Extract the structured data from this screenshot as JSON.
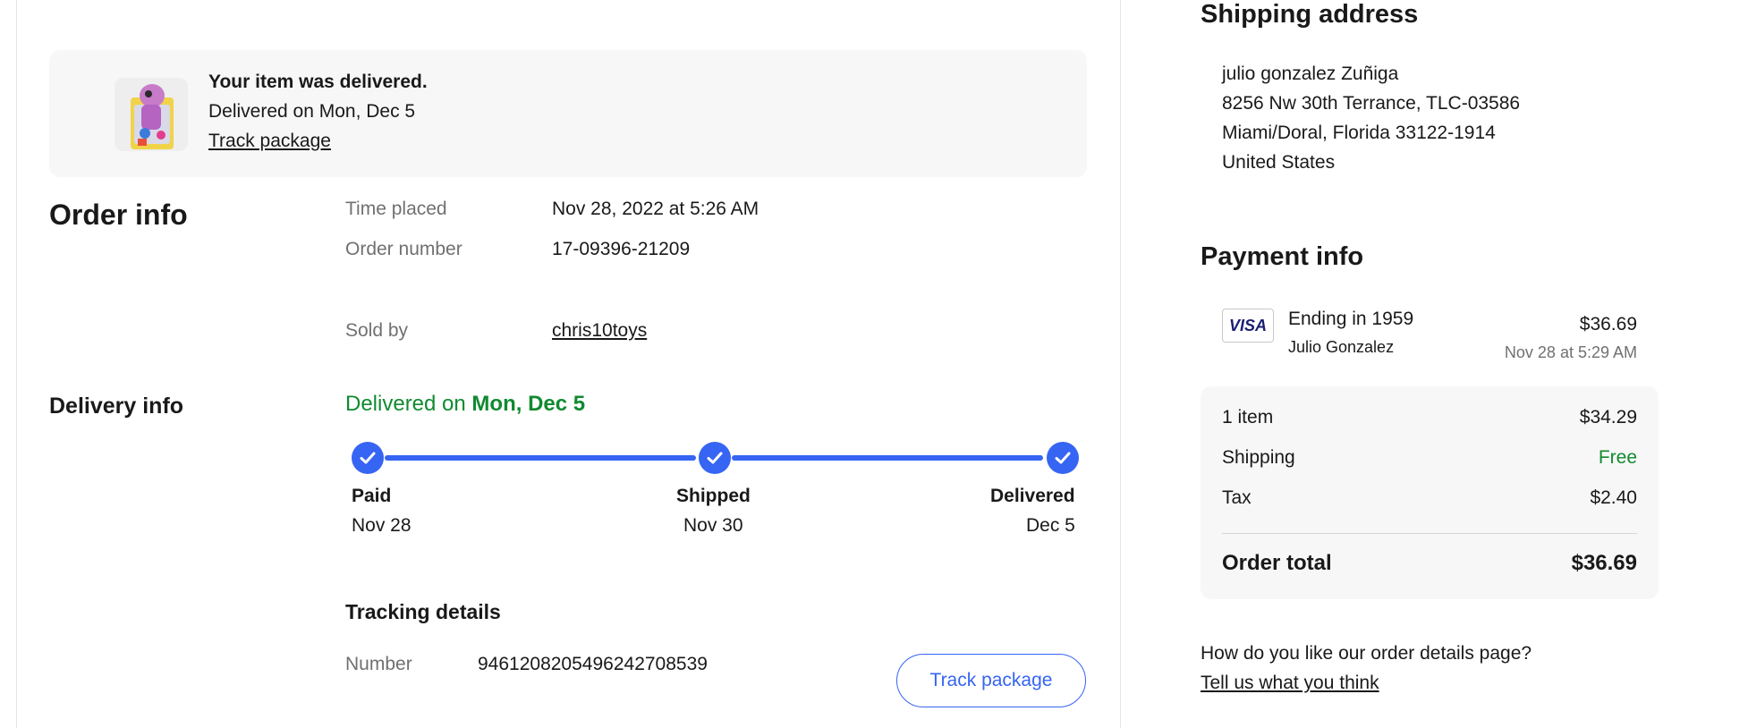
{
  "banner": {
    "title": "Your item was delivered.",
    "subtitle": "Delivered on Mon, Dec 5",
    "track_link": "Track package"
  },
  "order_info": {
    "heading": "Order info",
    "time_placed_label": "Time placed",
    "time_placed_value": "Nov 28, 2022 at 5:26 AM",
    "order_number_label": "Order number",
    "order_number_value": "17-09396-21209",
    "sold_by_label": "Sold by",
    "sold_by_value": "chris10toys"
  },
  "delivery_info": {
    "heading": "Delivery info",
    "status_prefix": "Delivered on ",
    "status_date": "Mon, Dec 5",
    "steps": [
      {
        "label": "Paid",
        "date": "Nov 28"
      },
      {
        "label": "Shipped",
        "date": "Nov 30"
      },
      {
        "label": "Delivered",
        "date": "Dec 5"
      }
    ],
    "tracking_heading": "Tracking details",
    "number_label": "Number",
    "number_value": "9461208205496242708539",
    "track_button": "Track package"
  },
  "shipping_address": {
    "heading": "Shipping address",
    "lines": [
      "julio gonzalez Zuñiga",
      "8256 Nw 30th Terrance, TLC-03586",
      "Miami/Doral, Florida 33122-1914",
      "United States"
    ]
  },
  "payment_info": {
    "heading": "Payment info",
    "card_brand": "VISA",
    "card_ending": "Ending in 1959",
    "card_holder": "Julio Gonzalez",
    "amount": "$36.69",
    "date": "Nov 28 at 5:29 AM"
  },
  "summary": {
    "items_label": "1 item",
    "items_value": "$34.29",
    "shipping_label": "Shipping",
    "shipping_value": "Free",
    "tax_label": "Tax",
    "tax_value": "$2.40",
    "total_label": "Order total",
    "total_value": "$36.69"
  },
  "feedback": {
    "question": "How do you like our order details page?",
    "link": "Tell us what you think"
  },
  "colors": {
    "accent_blue": "#3665f3",
    "success_green": "#118a30",
    "text_primary": "#191919",
    "text_secondary": "#707070",
    "panel_bg": "#f7f7f7"
  }
}
